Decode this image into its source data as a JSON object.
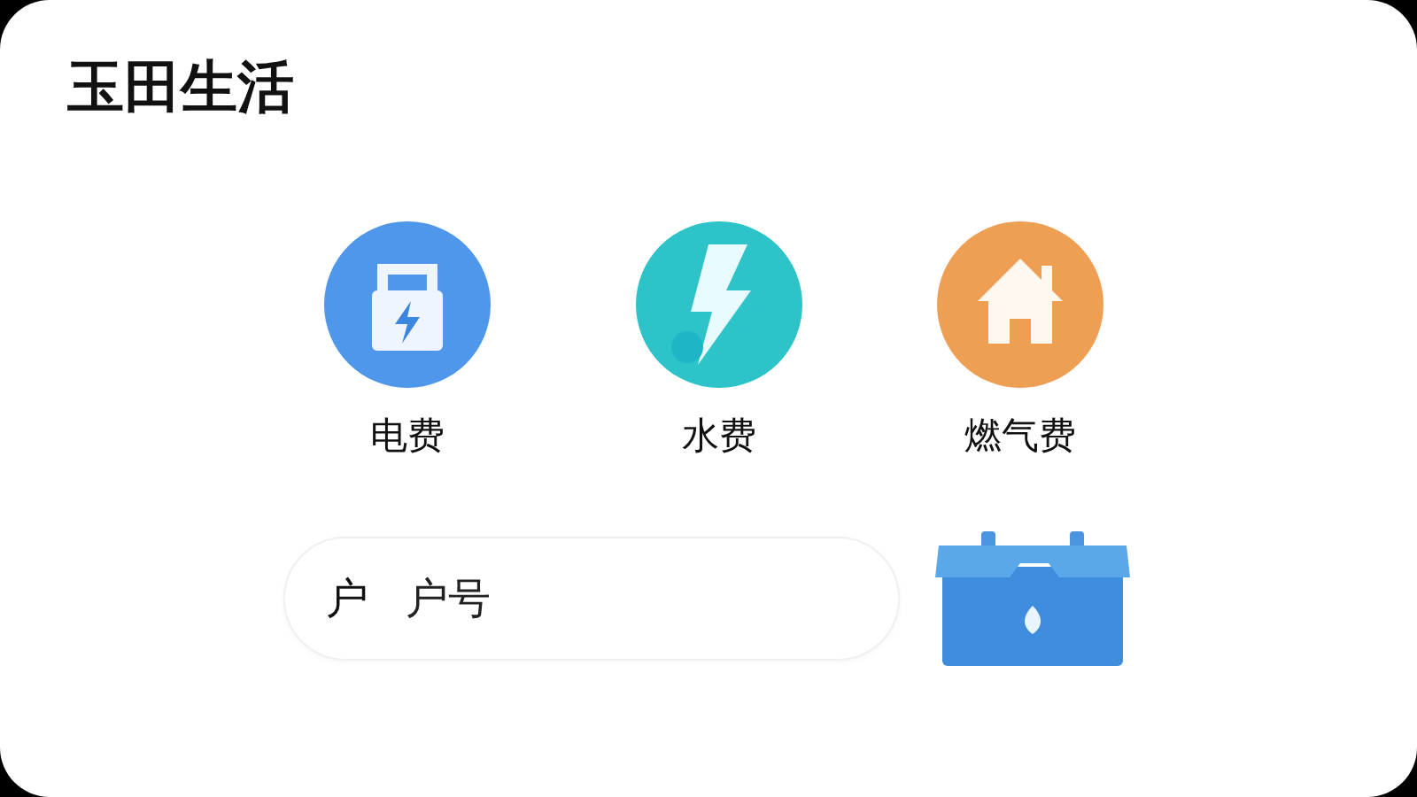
{
  "header": {
    "title": "玉田生活"
  },
  "services": [
    {
      "label": "电费",
      "kind": "electric"
    },
    {
      "label": "水费",
      "kind": "water"
    },
    {
      "label": "燃气费",
      "kind": "gas"
    }
  ],
  "account_field": {
    "label": "户",
    "placeholder": "户号"
  }
}
